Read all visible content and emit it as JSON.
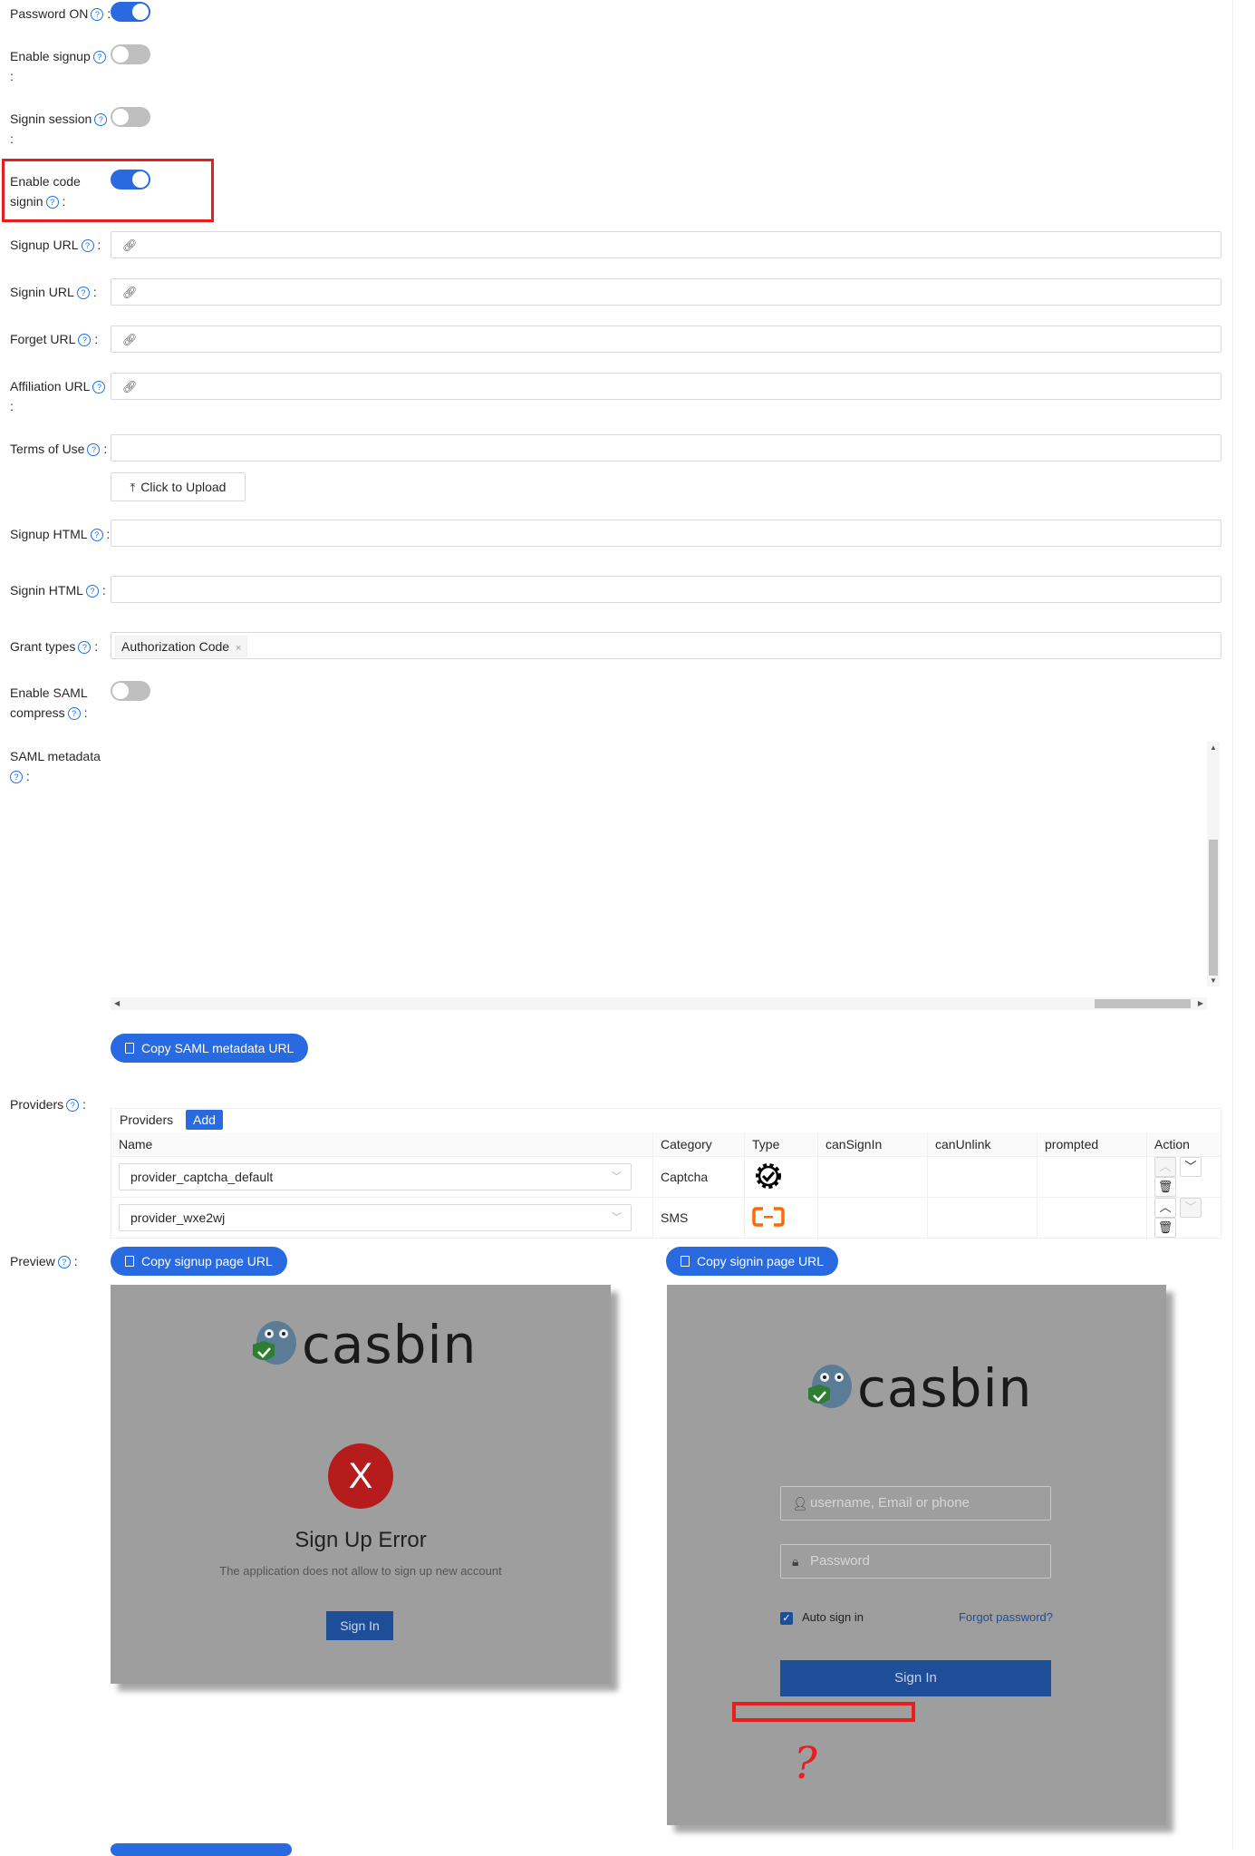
{
  "form": {
    "password_on": {
      "label": "Password ON",
      "colon": ":",
      "value": true
    },
    "enable_signup": {
      "label": "Enable signup",
      "colon": ":",
      "value": false
    },
    "signin_session": {
      "label": "Signin session",
      "colon": ":",
      "value": false
    },
    "enable_code_signin": {
      "label_line1": "Enable code",
      "label_line2": "signin",
      "colon": ":",
      "value": true
    },
    "signup_url": {
      "label": "Signup URL",
      "colon": ":",
      "value": ""
    },
    "signin_url": {
      "label": "Signin URL",
      "colon": ":",
      "value": ""
    },
    "forget_url": {
      "label": "Forget URL",
      "colon": ":",
      "value": ""
    },
    "affiliation_url": {
      "label": "Affiliation URL",
      "colon": ":",
      "value": ""
    },
    "terms_of_use": {
      "label": "Terms of Use",
      "colon": ":",
      "value": "",
      "upload_label": "Click to Upload"
    },
    "signup_html": {
      "label": "Signup HTML",
      "colon": ":",
      "value": ""
    },
    "signin_html": {
      "label": "Signin HTML",
      "colon": ":",
      "value": ""
    },
    "grant_types": {
      "label": "Grant types",
      "colon": ":",
      "tags": [
        "Authorization Code"
      ]
    },
    "enable_saml_compress": {
      "label_line1": "Enable SAML",
      "label_line2": "compress",
      "colon": ":",
      "value": false
    },
    "saml_metadata": {
      "label": "SAML metadata",
      "colon": ":",
      "copy_button": "Copy SAML metadata URL"
    },
    "providers": {
      "label": "Providers",
      "colon": ":",
      "tab_label": "Providers",
      "add_label": "Add",
      "columns": [
        "Name",
        "Category",
        "Type",
        "canSignIn",
        "canUnlink",
        "prompted",
        "Action"
      ],
      "rows": [
        {
          "name": "provider_captcha_default",
          "category": "Captcha",
          "type_icon": "gear-check-icon"
        },
        {
          "name": "provider_wxe2wj",
          "category": "SMS",
          "type_icon": "aliyun-icon"
        }
      ]
    },
    "preview": {
      "label": "Preview",
      "colon": ":",
      "copy_signup": "Copy signup page URL",
      "copy_signin": "Copy signin page URL"
    }
  },
  "signup_preview": {
    "logo_text": "casbin",
    "error_title": "Sign Up Error",
    "error_message": "The application does not allow to sign up new account",
    "button": "Sign In"
  },
  "signin_preview": {
    "logo_text": "casbin",
    "username_placeholder": "username, Email or phone",
    "password_placeholder": "Password",
    "auto_signin": "Auto sign in",
    "forgot": "Forgot password?",
    "button": "Sign In",
    "annotation": "?"
  },
  "colors": {
    "primary": "#2a6ae0",
    "annotation": "#e61e1e",
    "error": "#d32f2f",
    "preview_bg": "#9e9e9e"
  }
}
